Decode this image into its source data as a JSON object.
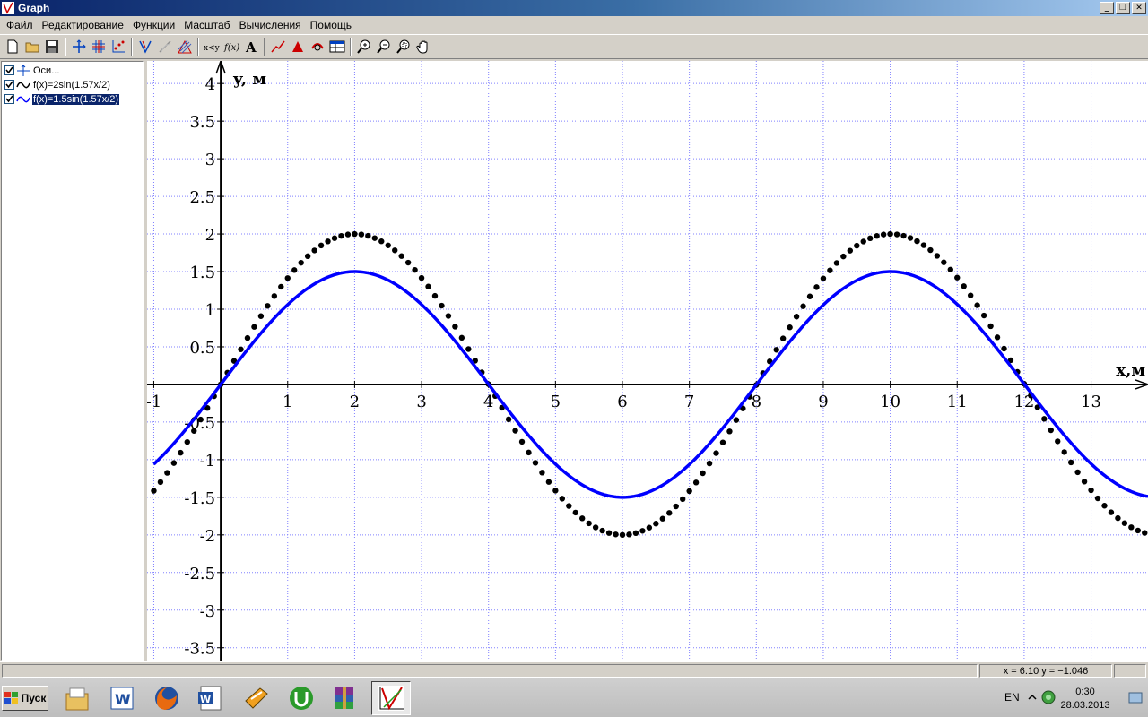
{
  "window": {
    "title": "Graph",
    "controls": [
      "_",
      "❐",
      "✕"
    ]
  },
  "menu": {
    "items": [
      "Файл",
      "Редактирование",
      "Функции",
      "Масштаб",
      "Вычисления",
      "Помощь"
    ]
  },
  "toolbar": {
    "buttons": [
      "new-icon",
      "open-icon",
      "save-icon",
      "axes-icon",
      "grid-icon",
      "point-series-icon",
      "function-icon",
      "tangent-icon",
      "shading-icon",
      "relation-icon",
      "custom-function-icon",
      "label-icon",
      "trendline-icon",
      "area-icon",
      "evaluate-icon",
      "table-icon",
      "zoom-in-icon",
      "zoom-out-icon",
      "zoom-window-icon",
      "pan-icon"
    ]
  },
  "tree": {
    "items": [
      {
        "label": "Оси...",
        "checked": true,
        "icon": "axes-icon",
        "selected": false
      },
      {
        "label": "f(x)=2sin(1.57x/2)",
        "checked": true,
        "icon": "curve-icon",
        "selected": false
      },
      {
        "label": "f(x)=1.5sin(1.57x/2)",
        "checked": true,
        "icon": "curve-icon",
        "selected": true
      }
    ]
  },
  "chart_data": {
    "type": "line",
    "xlabel": "x,м",
    "ylabel": "y, м",
    "xlim": [
      -1.1,
      13.85
    ],
    "ylim": [
      -3.67,
      4.3
    ],
    "x_ticks": [
      -1,
      1,
      2,
      3,
      4,
      5,
      6,
      7,
      8,
      9,
      10,
      11,
      12,
      13
    ],
    "y_ticks": [
      4,
      3.5,
      3,
      2.5,
      2,
      1.5,
      1,
      0.5,
      -0.5,
      -1,
      -1.5,
      -2,
      -2.5,
      -3,
      -3.5
    ],
    "y_tick_labels": [
      "4",
      "3.5",
      "3",
      "2.5",
      "2",
      "1.5",
      "1",
      "0.5",
      "-0.5",
      "-1",
      "-1.5",
      "-2",
      "-2.5",
      "-3",
      "-3.5"
    ],
    "x_tick_labels": [
      "-1",
      "1",
      "2",
      "3",
      "4",
      "5",
      "6",
      "7",
      "8",
      "9",
      "10",
      "11",
      "12",
      "13"
    ],
    "grid": true,
    "series": [
      {
        "formula": "2sin(1.57x/2)",
        "amplitude": 2,
        "k": 0.785,
        "style": "dotted",
        "color": "#000000",
        "x": [
          -1,
          0,
          1,
          2,
          3,
          4,
          5,
          6,
          7,
          8,
          9,
          10,
          11,
          12,
          13,
          13.85
        ],
        "y": [
          -1.41,
          0,
          1.41,
          2,
          1.42,
          0,
          -1.41,
          -2,
          -1.42,
          0,
          1.41,
          2,
          1.42,
          0,
          -1.41,
          -1.97
        ]
      },
      {
        "formula": "1.5sin(1.57x/2)",
        "amplitude": 1.5,
        "k": 0.785,
        "style": "solid",
        "color": "#0000ff",
        "x": [
          -1,
          0,
          1,
          2,
          3,
          4,
          5,
          6,
          7,
          8,
          9,
          10,
          11,
          12,
          13,
          13.85
        ],
        "y": [
          -1.06,
          0,
          1.06,
          1.5,
          1.06,
          0,
          -1.06,
          -1.5,
          -1.06,
          0,
          1.06,
          1.5,
          1.06,
          0,
          -1.06,
          -1.48
        ]
      }
    ]
  },
  "status": {
    "coords": "x = 6.10    y = −1.046"
  },
  "taskbar": {
    "start_label": "Пуск",
    "apps": [
      "explorer-icon",
      "word-icon",
      "firefox-icon",
      "word-doc-icon",
      "winamp-icon",
      "utorrent-icon",
      "winrar-icon",
      "graph-icon"
    ],
    "lang": "EN",
    "time": "0:30",
    "date": "28.03.2013"
  }
}
